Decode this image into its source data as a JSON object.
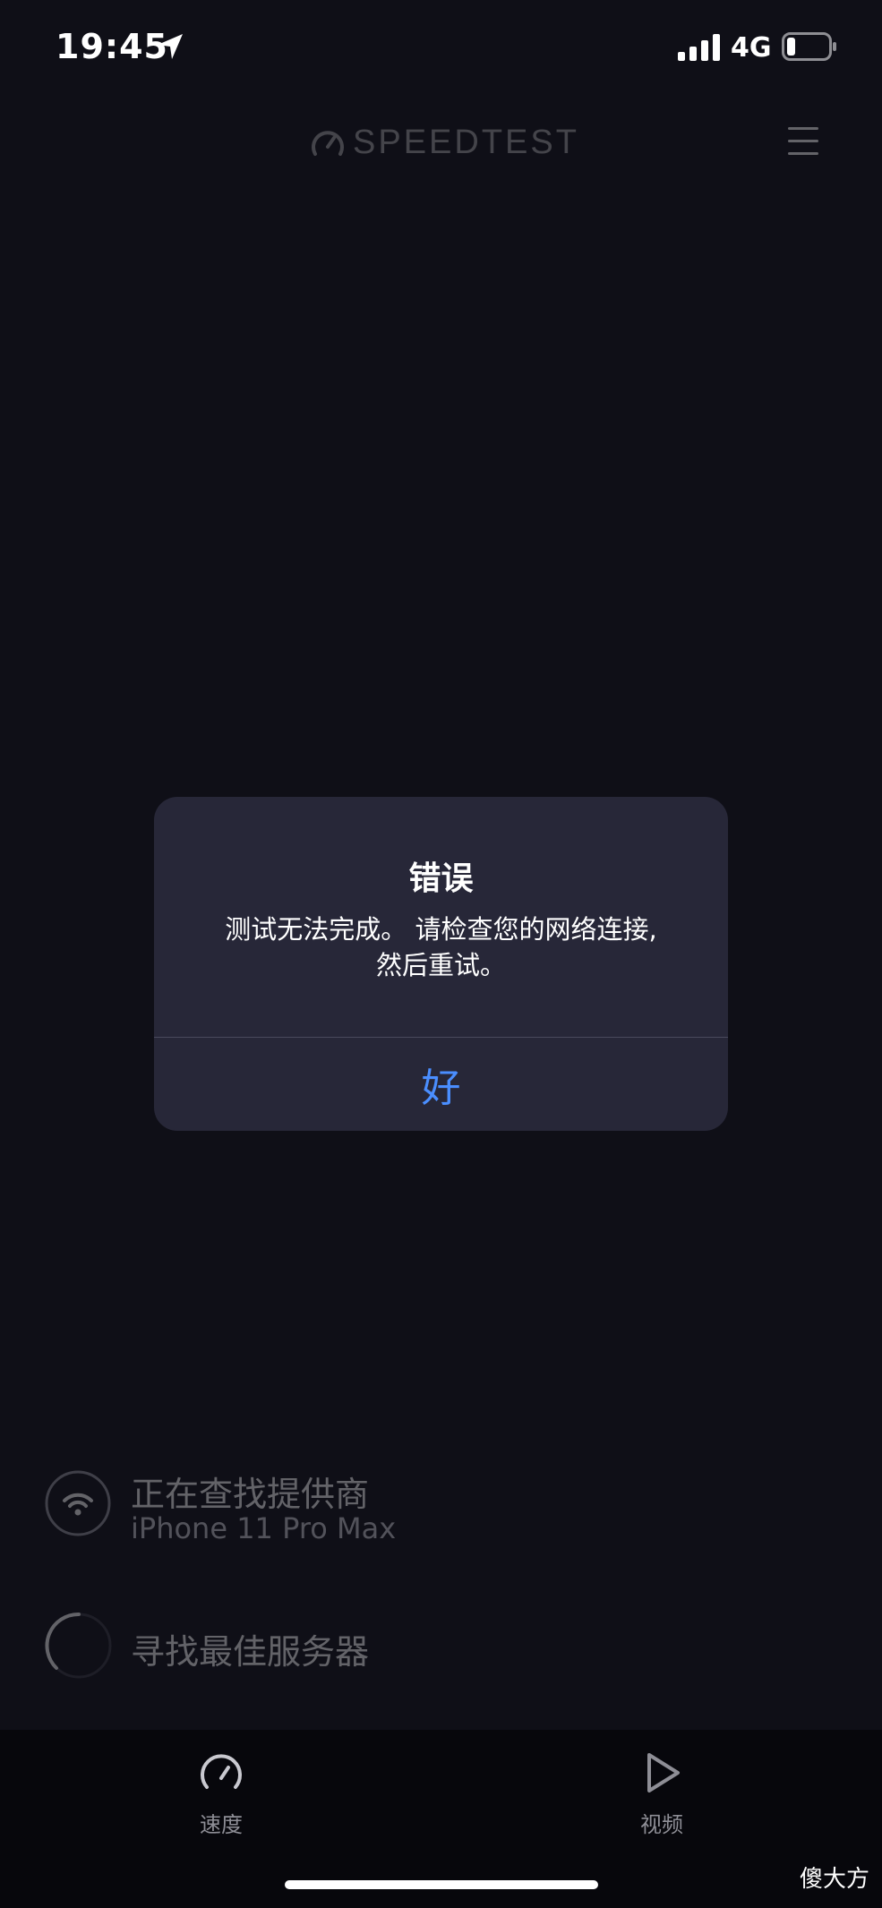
{
  "status_bar": {
    "time": "19:45",
    "location_icon": "location-arrow-icon",
    "signal_icon": "cellular-signal-icon",
    "network": "4G",
    "battery_icon": "battery-low-icon"
  },
  "header": {
    "logo_text": "SPEEDTEST",
    "logo_icon": "gauge-icon",
    "menu_icon": "hamburger-menu-icon"
  },
  "provider": {
    "title": "正在查找提供商",
    "device": "iPhone 11 Pro Max",
    "icon": "wifi-icon"
  },
  "server": {
    "title": "寻找最佳服务器",
    "icon": "spinner-icon"
  },
  "tabs": [
    {
      "label": "速度",
      "icon": "speedometer-icon"
    },
    {
      "label": "视频",
      "icon": "play-icon"
    }
  ],
  "dialog": {
    "title": "错误",
    "message_line1": "测试无法完成。 请检查您的网络连接,",
    "message_line2": "然后重试。",
    "button_label": "好",
    "accent_color": "#4a8eff"
  },
  "watermark": "傻大方"
}
